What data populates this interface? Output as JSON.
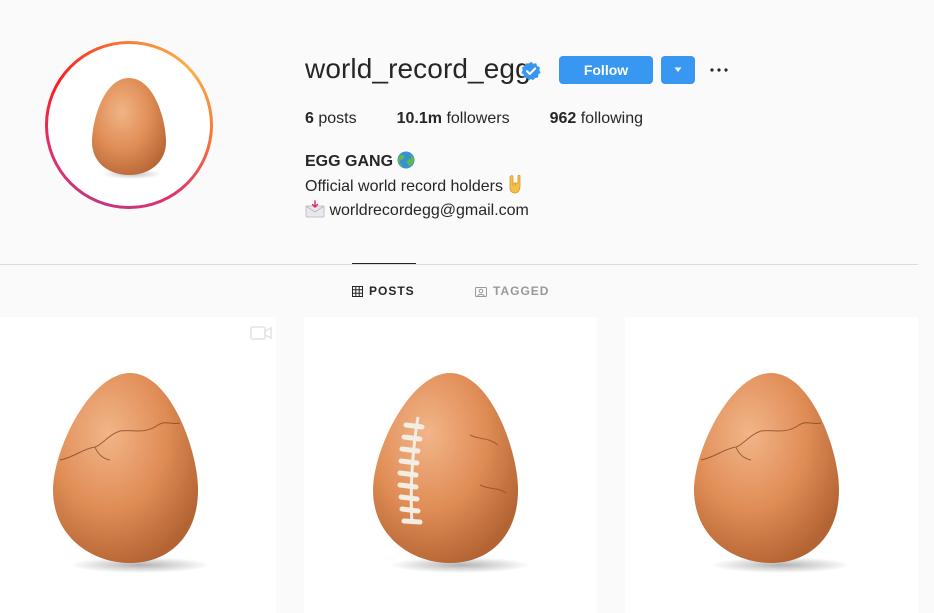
{
  "profile": {
    "username": "world_record_egg",
    "verified": true,
    "follow_label": "Follow",
    "stats": {
      "posts_count": "6",
      "posts_label": "posts",
      "followers_count": "10.1m",
      "followers_label": "followers",
      "following_count": "962",
      "following_label": "following"
    },
    "bio": {
      "name": "EGG GANG",
      "line1": "Official world record holders",
      "email": "worldrecordegg@gmail.com"
    }
  },
  "tabs": [
    {
      "label": "POSTS",
      "active": true,
      "icon": "grid-icon"
    },
    {
      "label": "TAGGED",
      "active": false,
      "icon": "tagged-icon"
    }
  ],
  "posts": [
    {
      "variant": "cracked",
      "has_video_icon": true
    },
    {
      "variant": "football",
      "has_video_icon": false
    },
    {
      "variant": "cracked",
      "has_video_icon": false
    }
  ],
  "colors": {
    "accent": "#3897f0",
    "background": "#fafafa",
    "egg": "#e08d56"
  }
}
